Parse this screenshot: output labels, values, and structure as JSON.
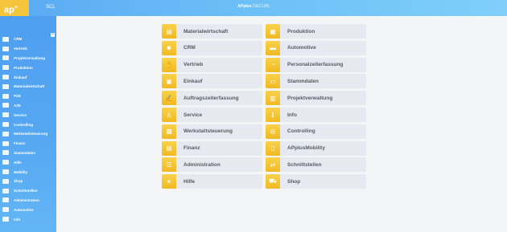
{
  "header": {
    "logo_text": "ap",
    "logo_suffix": "+",
    "app_short": "SCL",
    "title": "APplus",
    "edition": "(SECUR)"
  },
  "sidebar": {
    "collapse_symbol": "×",
    "items": [
      {
        "label": "CRM",
        "icon": "crm-icon"
      },
      {
        "label": "Vertrieb",
        "icon": "sales-icon"
      },
      {
        "label": "Projektverwaltung",
        "icon": "project-icon"
      },
      {
        "label": "Produktion",
        "icon": "production-icon"
      },
      {
        "label": "Einkauf",
        "icon": "purchase-icon"
      },
      {
        "label": "Materialwirtschaft",
        "icon": "material-icon"
      },
      {
        "label": "PZE",
        "icon": "time-icon"
      },
      {
        "label": "AZE",
        "icon": "order-time-icon"
      },
      {
        "label": "Service",
        "icon": "service-icon"
      },
      {
        "label": "Controlling",
        "icon": "controlling-icon"
      },
      {
        "label": "Werkstattsteuerung",
        "icon": "workshop-icon"
      },
      {
        "label": "Finanz",
        "icon": "finance-icon"
      },
      {
        "label": "Stammdaten",
        "icon": "masterdata-icon"
      },
      {
        "label": "Hilfe",
        "icon": "help-icon"
      },
      {
        "label": "Mobility",
        "icon": "mobility-icon"
      },
      {
        "label": "Shop",
        "icon": "shop-icon"
      },
      {
        "label": "Schnittstellen",
        "icon": "interface-icon"
      },
      {
        "label": "Administration",
        "icon": "admin-icon"
      },
      {
        "label": "Automotive",
        "icon": "automotive-icon"
      },
      {
        "label": "Info",
        "icon": "info-icon"
      }
    ]
  },
  "tiles": [
    {
      "label": "Materialwirtschaft",
      "icon": "material-icon",
      "glyph": "▤"
    },
    {
      "label": "Produktion",
      "icon": "production-icon",
      "glyph": "▦"
    },
    {
      "label": "CRM",
      "icon": "crm-icon",
      "glyph": "☻"
    },
    {
      "label": "Automotive",
      "icon": "automotive-icon",
      "glyph": "▬"
    },
    {
      "label": "Vertrieb",
      "icon": "sales-icon",
      "glyph": "✋"
    },
    {
      "label": "Personalzeiterfassung",
      "icon": "time-icon",
      "glyph": "◔"
    },
    {
      "label": "Einkauf",
      "icon": "purchase-icon",
      "glyph": "▣"
    },
    {
      "label": "Stammdaten",
      "icon": "masterdata-icon",
      "glyph": "▭"
    },
    {
      "label": "Auftragszeiterfassung",
      "icon": "order-time-icon",
      "glyph": "✍"
    },
    {
      "label": "Projektverwaltung",
      "icon": "project-icon",
      "glyph": "▥"
    },
    {
      "label": "Service",
      "icon": "service-icon",
      "glyph": "♙"
    },
    {
      "label": "Info",
      "icon": "info-icon",
      "glyph": "ℹ"
    },
    {
      "label": "Werkstattsteuerung",
      "icon": "workshop-icon",
      "glyph": "▩"
    },
    {
      "label": "Controlling",
      "icon": "controlling-icon",
      "glyph": "◎"
    },
    {
      "label": "Finanz",
      "icon": "finance-icon",
      "glyph": "▤"
    },
    {
      "label": "APplusMobility",
      "icon": "mobility-icon",
      "glyph": "▯"
    },
    {
      "label": "Administration",
      "icon": "admin-icon",
      "glyph": "☰"
    },
    {
      "label": "Schnittstellen",
      "icon": "interface-icon",
      "glyph": "⇄"
    },
    {
      "label": "Hilfe",
      "icon": "help-icon",
      "glyph": "☀"
    },
    {
      "label": "Shop",
      "icon": "shop-icon",
      "glyph": "⛟"
    }
  ]
}
